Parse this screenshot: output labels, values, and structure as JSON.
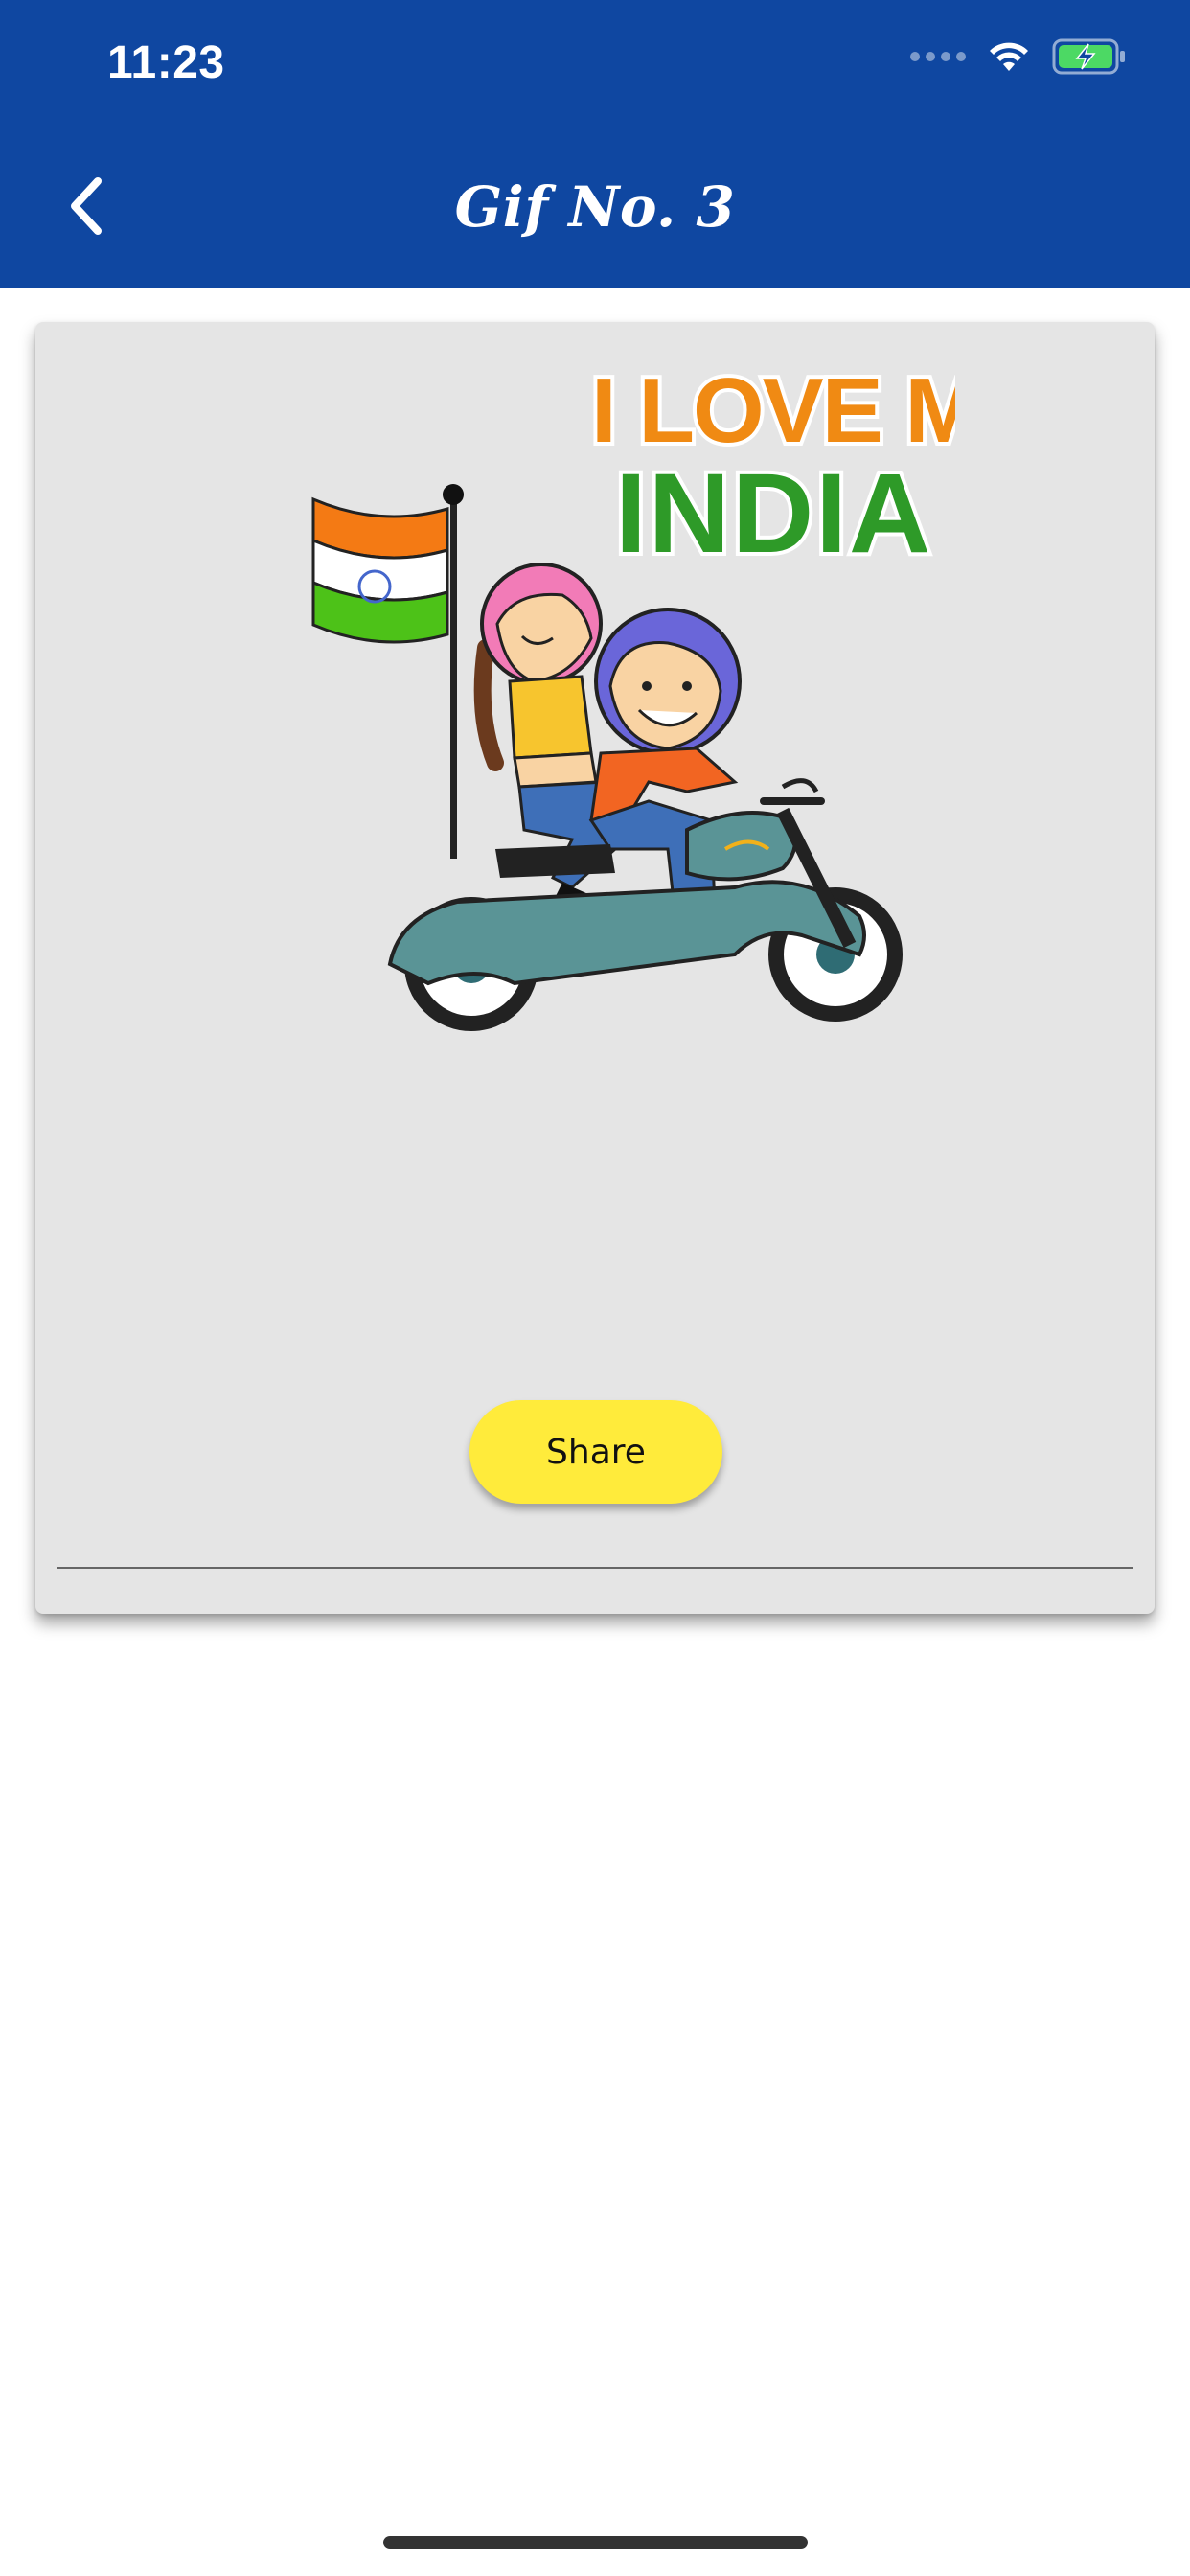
{
  "status_bar": {
    "time": "11:23",
    "icons": [
      "cellular-dots-icon",
      "wifi-icon",
      "battery-charging-icon"
    ]
  },
  "nav_bar": {
    "title": "Gif No. 3",
    "back_icon": "chevron-left-icon"
  },
  "card": {
    "gif": {
      "line1": "I LOVE MY",
      "line2": "INDIA"
    },
    "share_label": "Share"
  },
  "colors": {
    "nav_background": "#0F47A1",
    "card_background": "#E5E5E5",
    "share_button": "#FFEB3B"
  }
}
